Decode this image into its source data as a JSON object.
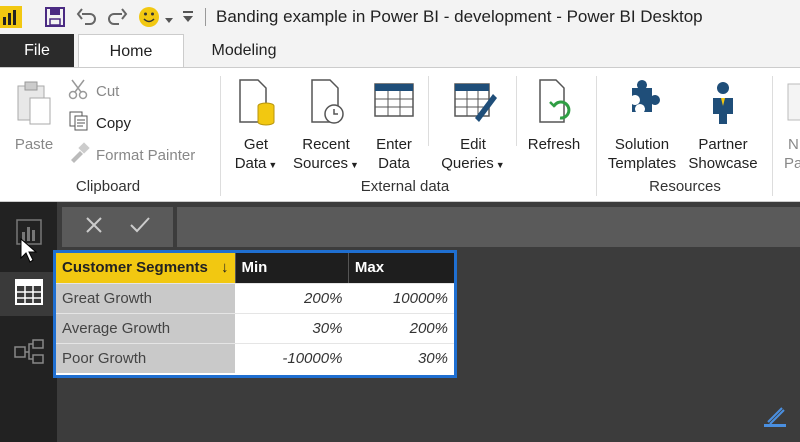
{
  "window": {
    "title": "Banding example in Power BI - development - Power BI Desktop"
  },
  "tabs": {
    "file": "File",
    "home": "Home",
    "modeling": "Modeling"
  },
  "ribbon": {
    "clipboard": {
      "paste": "Paste",
      "cut": "Cut",
      "copy": "Copy",
      "format_painter": "Format Painter",
      "group_label": "Clipboard"
    },
    "external_data": {
      "get_data": [
        "Get",
        "Data"
      ],
      "recent_sources": [
        "Recent",
        "Sources"
      ],
      "enter_data": [
        "Enter",
        "Data"
      ],
      "edit_queries": [
        "Edit",
        "Queries"
      ],
      "refresh": "Refresh",
      "group_label": "External data"
    },
    "resources": {
      "solution_templates": [
        "Solution",
        "Templates"
      ],
      "partner_showcase": [
        "Partner",
        "Showcase"
      ],
      "group_label": "Resources"
    },
    "overflow": [
      "N",
      "Pa"
    ]
  },
  "table": {
    "headers": [
      "Customer Segments",
      "Min",
      "Max"
    ],
    "rows": [
      [
        "Great Growth",
        "200%",
        "10000%"
      ],
      [
        "Average Growth",
        "30%",
        "200%"
      ],
      [
        "Poor Growth",
        "-10000%",
        "30%"
      ]
    ]
  },
  "colors": {
    "accent": "#f2c811",
    "selection_border": "#1f6fd1",
    "file_tab": "#2b2b2b"
  }
}
